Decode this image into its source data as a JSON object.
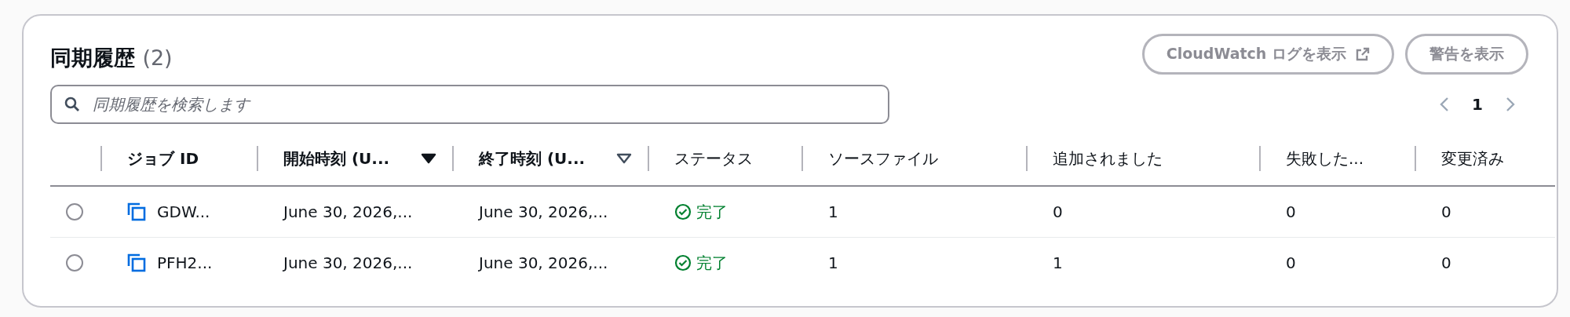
{
  "header": {
    "title": "同期履歴",
    "count": "(2)"
  },
  "buttons": [
    {
      "label": "CloudWatch ログを表示",
      "kind": "external",
      "disabled": true
    },
    {
      "label": "警告を表示",
      "kind": "plain",
      "disabled": true
    }
  ],
  "search": {
    "placeholder": "同期履歴を検索します"
  },
  "pagination": {
    "pages": [
      {
        "label": "1",
        "selected": true
      }
    ],
    "prev_disabled": true,
    "next_disabled": true
  },
  "table": {
    "columns": [
      {
        "label": "ジョブ ID"
      },
      {
        "label": "開始時刻 (U...",
        "sorted": true
      },
      {
        "label": "終了時刻 (U...",
        "sorted": false
      },
      {
        "label": "ステータス"
      },
      {
        "label": "ソースファイル"
      },
      {
        "label": "追加されました"
      },
      {
        "label": "失敗した..."
      },
      {
        "label": "変更済み"
      }
    ],
    "rows": [
      {
        "selected": false,
        "job_id": "GDW...",
        "start": "June 30, 2026,...",
        "end": "June 30, 2026,...",
        "status": {
          "text": "完了",
          "kind": "success"
        },
        "source": "1",
        "added": "0",
        "failed": "0",
        "changed": "0"
      },
      {
        "selected": false,
        "job_id": "PFH2...",
        "start": "June 30, 2026,...",
        "end": "June 30, 2026,...",
        "status": {
          "text": "完了",
          "kind": "success"
        },
        "source": "1",
        "added": "1",
        "failed": "0",
        "changed": "0"
      }
    ]
  }
}
